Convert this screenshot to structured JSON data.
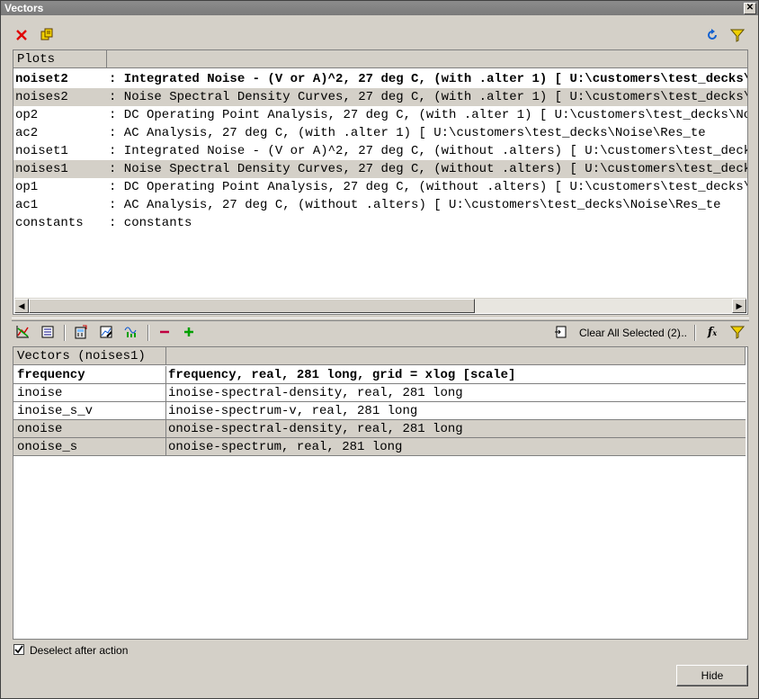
{
  "window": {
    "title": "Vectors",
    "close_glyph": "✕"
  },
  "top_toolbar": {
    "delete_icon": "red-x-icon",
    "copy_icon": "copy-plot-icon",
    "refresh_icon": "refresh-icon",
    "filter_icon": "filter-funnel-icon"
  },
  "plots": {
    "header": "Plots",
    "rows": [
      {
        "name": "noiset2",
        "desc": ": Integrated Noise - (V or A)^2, 27 deg C, (with .alter 1) [ U:\\customers\\test_decks\\Noise\\Res_te",
        "bold": true,
        "selected": false
      },
      {
        "name": "noises2",
        "desc": ": Noise Spectral Density Curves, 27 deg C, (with .alter 1) [ U:\\customers\\test_decks\\Noise\\Res_te",
        "bold": false,
        "selected": true
      },
      {
        "name": "op2",
        "desc": ": DC Operating Point Analysis, 27 deg C, (with .alter 1) [ U:\\customers\\test_decks\\Noise\\Res_te",
        "bold": false,
        "selected": false
      },
      {
        "name": "ac2",
        "desc": ": AC Analysis, 27 deg C, (with .alter 1) [ U:\\customers\\test_decks\\Noise\\Res_te",
        "bold": false,
        "selected": false
      },
      {
        "name": "noiset1",
        "desc": ": Integrated Noise - (V or A)^2, 27 deg C, (without .alters) [ U:\\customers\\test_decks\\Noise\\Res_te",
        "bold": false,
        "selected": false
      },
      {
        "name": "noises1",
        "desc": ": Noise Spectral Density Curves, 27 deg C, (without .alters) [ U:\\customers\\test_decks\\Noise\\Res_te",
        "bold": false,
        "selected": true
      },
      {
        "name": "op1",
        "desc": ": DC Operating Point Analysis, 27 deg C, (without .alters) [ U:\\customers\\test_decks\\Noise\\Res_te",
        "bold": false,
        "selected": false
      },
      {
        "name": "ac1",
        "desc": ": AC Analysis, 27 deg C, (without .alters) [ U:\\customers\\test_decks\\Noise\\Res_te",
        "bold": false,
        "selected": false
      },
      {
        "name": "constants",
        "desc": ": constants",
        "bold": false,
        "selected": false
      }
    ]
  },
  "vector_toolbar": {
    "clear_all_label": "Clear All Selected (2)",
    "more_label": "...",
    "fx_label": "f"
  },
  "vectors": {
    "header": "Vectors (noises1)",
    "rows": [
      {
        "name": "frequency",
        "desc": "frequency, real, 281 long, grid = xlog [scale]",
        "bold": true,
        "selected": false
      },
      {
        "name": "inoise",
        "desc": "inoise-spectral-density, real, 281 long",
        "bold": false,
        "selected": false
      },
      {
        "name": "inoise_s_v",
        "desc": "inoise-spectrum-v, real, 281 long",
        "bold": false,
        "selected": false
      },
      {
        "name": "onoise",
        "desc": "onoise-spectral-density, real, 281 long",
        "bold": false,
        "selected": true
      },
      {
        "name": "onoise_s",
        "desc": "onoise-spectrum, real, 281 long",
        "bold": false,
        "selected": true
      }
    ]
  },
  "footer": {
    "deselect_label": "Deselect after action",
    "deselect_checked": true,
    "hide_label": "Hide"
  }
}
